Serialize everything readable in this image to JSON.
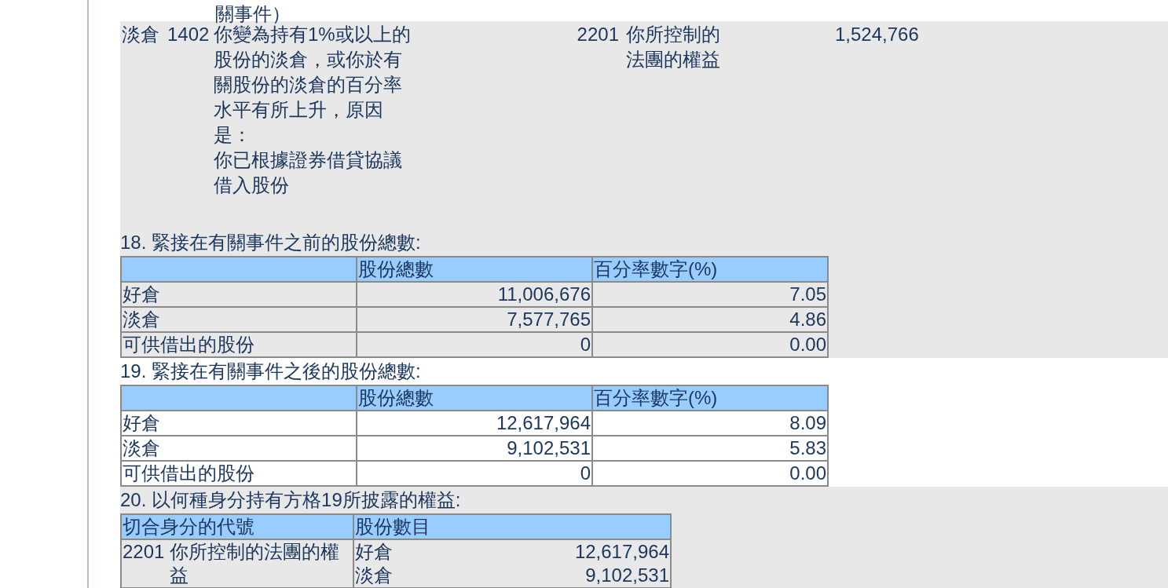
{
  "continued_text": "關事件）",
  "interest_row": {
    "position": "淡倉",
    "code": "1402",
    "description": [
      "你變為持有1%或以上的股份的淡倉，或你於有關股份的淡倉的百分率水平有所上升，原因是：",
      "你已根據證券借貸協議借入股份"
    ],
    "capacity_code": "2201",
    "capacity": "你所控制的法團的權益",
    "shares": "1,524,766"
  },
  "sections": [
    {
      "title": "18. 緊接在有關事件之前的股份總數:",
      "shaded": true,
      "columns": [
        "股份總數",
        "百分率數字(%)"
      ],
      "rows": [
        {
          "label": "好倉",
          "shares": "11,006,676",
          "percent": "7.05"
        },
        {
          "label": "淡倉",
          "shares": "7,577,765",
          "percent": "4.86"
        },
        {
          "label": "可供借出的股份",
          "shares": "0",
          "percent": "0.00"
        }
      ]
    },
    {
      "title": "19. 緊接在有關事件之後的股份總數:",
      "shaded": false,
      "columns": [
        "股份總數",
        "百分率數字(%)"
      ],
      "rows": [
        {
          "label": "好倉",
          "shares": "12,617,964",
          "percent": "8.09"
        },
        {
          "label": "淡倉",
          "shares": "9,102,531",
          "percent": "5.83"
        },
        {
          "label": "可供借出的股份",
          "shares": "0",
          "percent": "0.00"
        }
      ]
    }
  ],
  "capacity_section": {
    "title": "20. 以何種身分持有方格19所披露的權益:",
    "shaded": true,
    "columns": [
      "切合身分的代號",
      "股份數目"
    ],
    "rows": [
      {
        "code": "2201",
        "capacity": "你所控制的法團的權益",
        "holdings": [
          {
            "position": "好倉",
            "shares": "12,617,964"
          },
          {
            "position": "淡倉",
            "shares": "9,102,531"
          }
        ]
      }
    ]
  }
}
